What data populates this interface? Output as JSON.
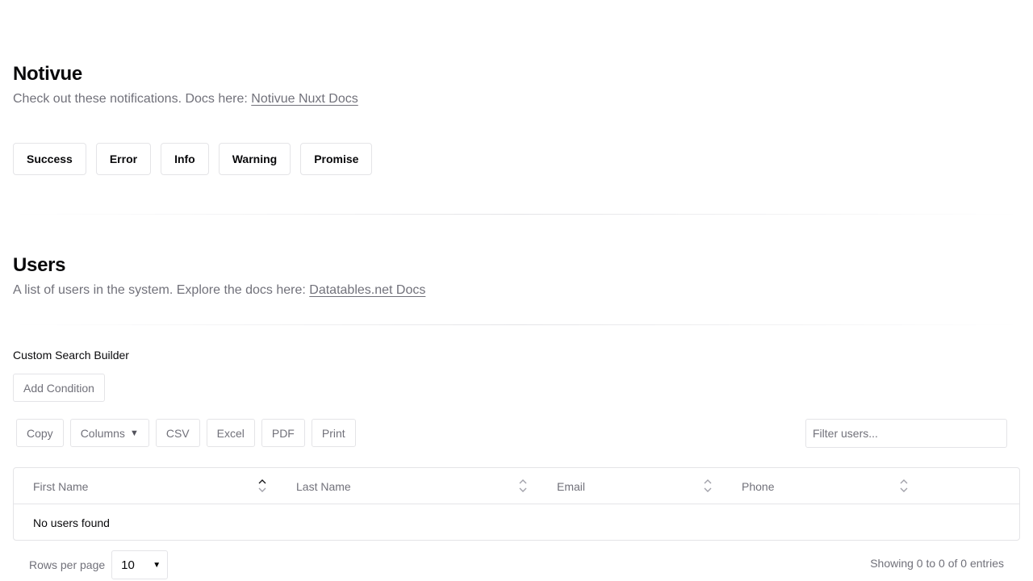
{
  "notivue": {
    "title": "Notivue",
    "subtitle_text": "Check out these notifications. Docs here: ",
    "docs_link": "Notivue Nuxt Docs",
    "buttons": [
      "Success",
      "Error",
      "Info",
      "Warning",
      "Promise"
    ]
  },
  "users": {
    "title": "Users",
    "subtitle_text": "A list of users in the system. Explore the docs here: ",
    "docs_link": "Datatables.net Docs"
  },
  "search_builder": {
    "title": "Custom Search Builder",
    "add_condition": "Add Condition"
  },
  "toolbar": {
    "copy": "Copy",
    "columns": "Columns",
    "csv": "CSV",
    "excel": "Excel",
    "pdf": "PDF",
    "print": "Print",
    "filter_placeholder": "Filter users..."
  },
  "table": {
    "columns": [
      "First Name",
      "Last Name",
      "Email",
      "Phone"
    ],
    "empty_text": "No users found"
  },
  "footer": {
    "rows_per_page_label": "Rows per page",
    "rows_per_page_value": "10",
    "info": "Showing 0 to 0 of 0 entries"
  }
}
